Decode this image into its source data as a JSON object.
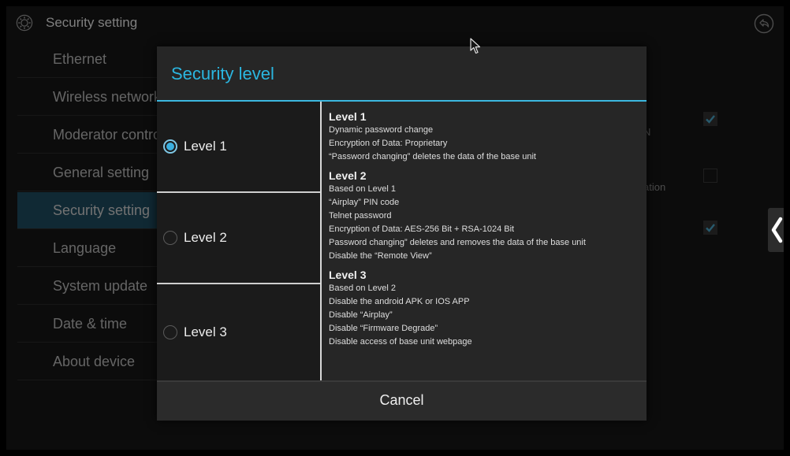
{
  "app": {
    "title": "Security setting",
    "gear_icon": "gear-icon",
    "back_icon": "back-arrow-icon"
  },
  "sidebar": {
    "items": [
      {
        "label": "Ethernet",
        "active": false
      },
      {
        "label": "Wireless network",
        "active": false
      },
      {
        "label": "Moderator control",
        "active": false
      },
      {
        "label": "General setting",
        "active": false
      },
      {
        "label": "Security setting",
        "active": true
      },
      {
        "label": "Language",
        "active": false
      },
      {
        "label": "System update",
        "active": false
      },
      {
        "label": "Date & time",
        "active": false
      },
      {
        "label": "About device",
        "active": false
      }
    ]
  },
  "background": {
    "partial_text_1": "N",
    "partial_text_2": "ation",
    "checkbox_1_checked": true,
    "checkbox_2_checked": false,
    "checkbox_3_checked": true,
    "side_tab_icon": "chevron-left-icon"
  },
  "dialog": {
    "title": "Security level",
    "options": [
      {
        "label": "Level 1",
        "selected": true
      },
      {
        "label": "Level 2",
        "selected": false
      },
      {
        "label": "Level 3",
        "selected": false
      }
    ],
    "descriptions": [
      {
        "heading": "Level 1",
        "lines": [
          "Dynamic password change",
          "Encryption of Data: Proprietary",
          "“Password changing” deletes the data of the base unit"
        ]
      },
      {
        "heading": "Level 2",
        "lines": [
          "Based on Level 1",
          "“Airplay” PIN code",
          "Telnet password",
          "Encryption of Data: AES-256 Bit + RSA-1024 Bit",
          "Password changing” deletes and removes the data of the base unit",
          "Disable the “Remote View”"
        ]
      },
      {
        "heading": "Level 3",
        "lines": [
          "Based on Level 2",
          "Disable the android APK or IOS APP",
          "Disable “Airplay”",
          "Disable “Firmware Degrade”",
          "Disable access of base unit webpage"
        ]
      }
    ],
    "cancel_label": "Cancel"
  },
  "colors": {
    "accent": "#3bb0e0",
    "title_color": "#2bb6e0",
    "active_sidebar": "#1e4b5f"
  }
}
